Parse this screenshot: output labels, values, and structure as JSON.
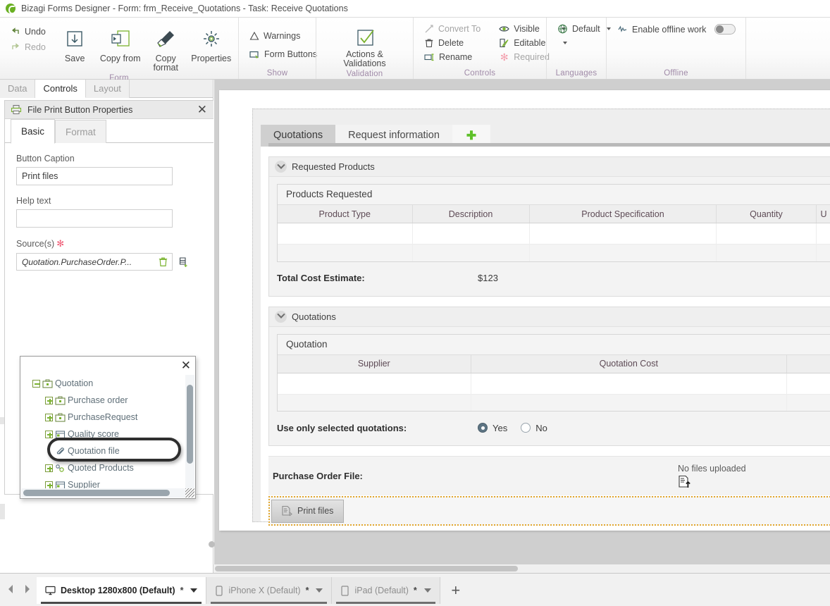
{
  "window": {
    "app_name": "Bizagi Forms Designer",
    "title": "Bizagi Forms Designer  - Form: frm_Receive_Quotations - Task:  Receive Quotations"
  },
  "ribbon": {
    "groups": [
      {
        "label": "Form",
        "small_buttons": [
          {
            "label": "Undo",
            "icon": "undo-icon"
          },
          {
            "label": "Redo",
            "icon": "redo-icon"
          }
        ],
        "big_buttons": [
          {
            "label": "Save",
            "icon": "save-icon"
          },
          {
            "label": "Copy from",
            "icon": "copy-from-icon"
          },
          {
            "label": "Copy format",
            "icon": "copy-format-icon"
          },
          {
            "label": "Properties",
            "icon": "gear-icon"
          }
        ]
      },
      {
        "label": "Show",
        "small_buttons": [
          {
            "label": "Warnings",
            "icon": "warning-icon"
          },
          {
            "label": "Form Buttons",
            "icon": "form-buttons-icon"
          }
        ]
      },
      {
        "label": "Validation",
        "big_buttons": [
          {
            "label": "Actions & Validations",
            "icon": "checkmark-box-icon"
          }
        ]
      },
      {
        "label": "Controls",
        "small_buttons": [
          {
            "label": "Convert To",
            "icon": "convert-to-icon",
            "disabled": true
          },
          {
            "label": "Delete",
            "icon": "trash-icon"
          },
          {
            "label": "Rename",
            "icon": "rename-icon"
          }
        ],
        "small_buttons_2": [
          {
            "label": "Visible",
            "icon": "eye-icon",
            "dropdown": true
          },
          {
            "label": "Editable",
            "icon": "pencil-page-icon",
            "dropdown": true
          },
          {
            "label": "Required",
            "icon": "asterisk-icon",
            "disabled": true
          }
        ]
      },
      {
        "label": "Languages",
        "small_buttons": [
          {
            "label": "Default",
            "icon": "globe-icon",
            "dropdown": true
          }
        ]
      },
      {
        "label": "Offline",
        "small_buttons": [
          {
            "label": "Enable offline work",
            "icon": "offline-icon",
            "toggle": "off"
          }
        ]
      }
    ]
  },
  "left_panel": {
    "tabs": [
      {
        "label": "Data",
        "active": false
      },
      {
        "label": "Controls",
        "active": true
      },
      {
        "label": "Layout",
        "active": false
      }
    ],
    "properties": {
      "header_title": "File Print Button Properties",
      "header_icon": "printer-icon",
      "close_label": "✕",
      "tabs": [
        {
          "label": "Basic",
          "active": true
        },
        {
          "label": "Format",
          "active": false
        }
      ],
      "fields": {
        "button_caption_label": "Button Caption",
        "button_caption_value": "Print files",
        "help_text_label": "Help text",
        "help_text_value": "",
        "help_text_placeholder": "",
        "sources_label": "Source(s)",
        "sources_required_mark": "✻",
        "sources_value": "Quotation.PurchaseOrder.P...",
        "delete_source_icon": "trash-icon",
        "add_source_icon": "add-data-icon"
      }
    },
    "tree_popup": {
      "close_label": "✕",
      "highlighted_node": "Quotation file",
      "nodes": [
        {
          "label": "Quotation",
          "depth": 0,
          "expander": "minus",
          "icon": "entity-icon"
        },
        {
          "label": "Purchase order",
          "depth": 1,
          "expander": "plus",
          "icon": "entity-icon"
        },
        {
          "label": "PurchaseRequest",
          "depth": 1,
          "expander": "plus",
          "icon": "entity-icon"
        },
        {
          "label": "Quality score",
          "depth": 1,
          "expander": "plus",
          "icon": "table-icon"
        },
        {
          "label": "Quotation file",
          "depth": 1,
          "expander": "none",
          "icon": "paperclip-icon"
        },
        {
          "label": "Quoted Products",
          "depth": 1,
          "expander": "plus",
          "icon": "collection-icon"
        },
        {
          "label": "Supplier",
          "depth": 1,
          "expander": "plus",
          "icon": "table-icon"
        }
      ]
    }
  },
  "form": {
    "tabs": [
      {
        "label": "Quotations",
        "active": true
      },
      {
        "label": "Request information",
        "active": false
      },
      {
        "label": "",
        "add": true,
        "icon": "plus-icon"
      }
    ],
    "sections": [
      {
        "title": "Requested Products",
        "grid": {
          "title": "Products Requested",
          "columns": [
            "Product Type",
            "Description",
            "Product Specification",
            "Quantity",
            "U"
          ],
          "rows": []
        },
        "kv": {
          "label": "Total Cost Estimate:",
          "value": "$123"
        }
      },
      {
        "title": "Quotations",
        "grid": {
          "title": "Quotation",
          "columns": [
            "Supplier",
            "Quotation Cost",
            ""
          ],
          "rows": []
        },
        "radio_field": {
          "label": "Use only selected quotations:",
          "options": [
            {
              "label": "Yes",
              "selected": true
            },
            {
              "label": "No",
              "selected": false
            }
          ]
        }
      }
    ],
    "purchase_order_file": {
      "label": "Purchase Order File:",
      "status": "No files uploaded",
      "icon": "file-upload-icon"
    },
    "button_band": {
      "button_label": "Print files",
      "button_icon": "print-file-icon",
      "selected": true
    }
  },
  "device_bar": {
    "prev_icon": "arrow-left-icon",
    "next_icon": "arrow-right-icon",
    "add_label": "+",
    "tabs": [
      {
        "label": "Desktop 1280x800 (Default)",
        "star": "*",
        "icon": "monitor-icon",
        "active": true
      },
      {
        "label": "iPhone X (Default)",
        "star": "*",
        "icon": "phone-icon",
        "active": false
      },
      {
        "label": "iPad (Default)",
        "star": "*",
        "icon": "tablet-icon",
        "active": false
      }
    ]
  },
  "colors": {
    "brand_green": "#6ab023",
    "group_label": "#a08aa8",
    "selection_orange": "#e2a72e",
    "header_text": "#5d4a55",
    "radio_on": "#5d7483"
  }
}
